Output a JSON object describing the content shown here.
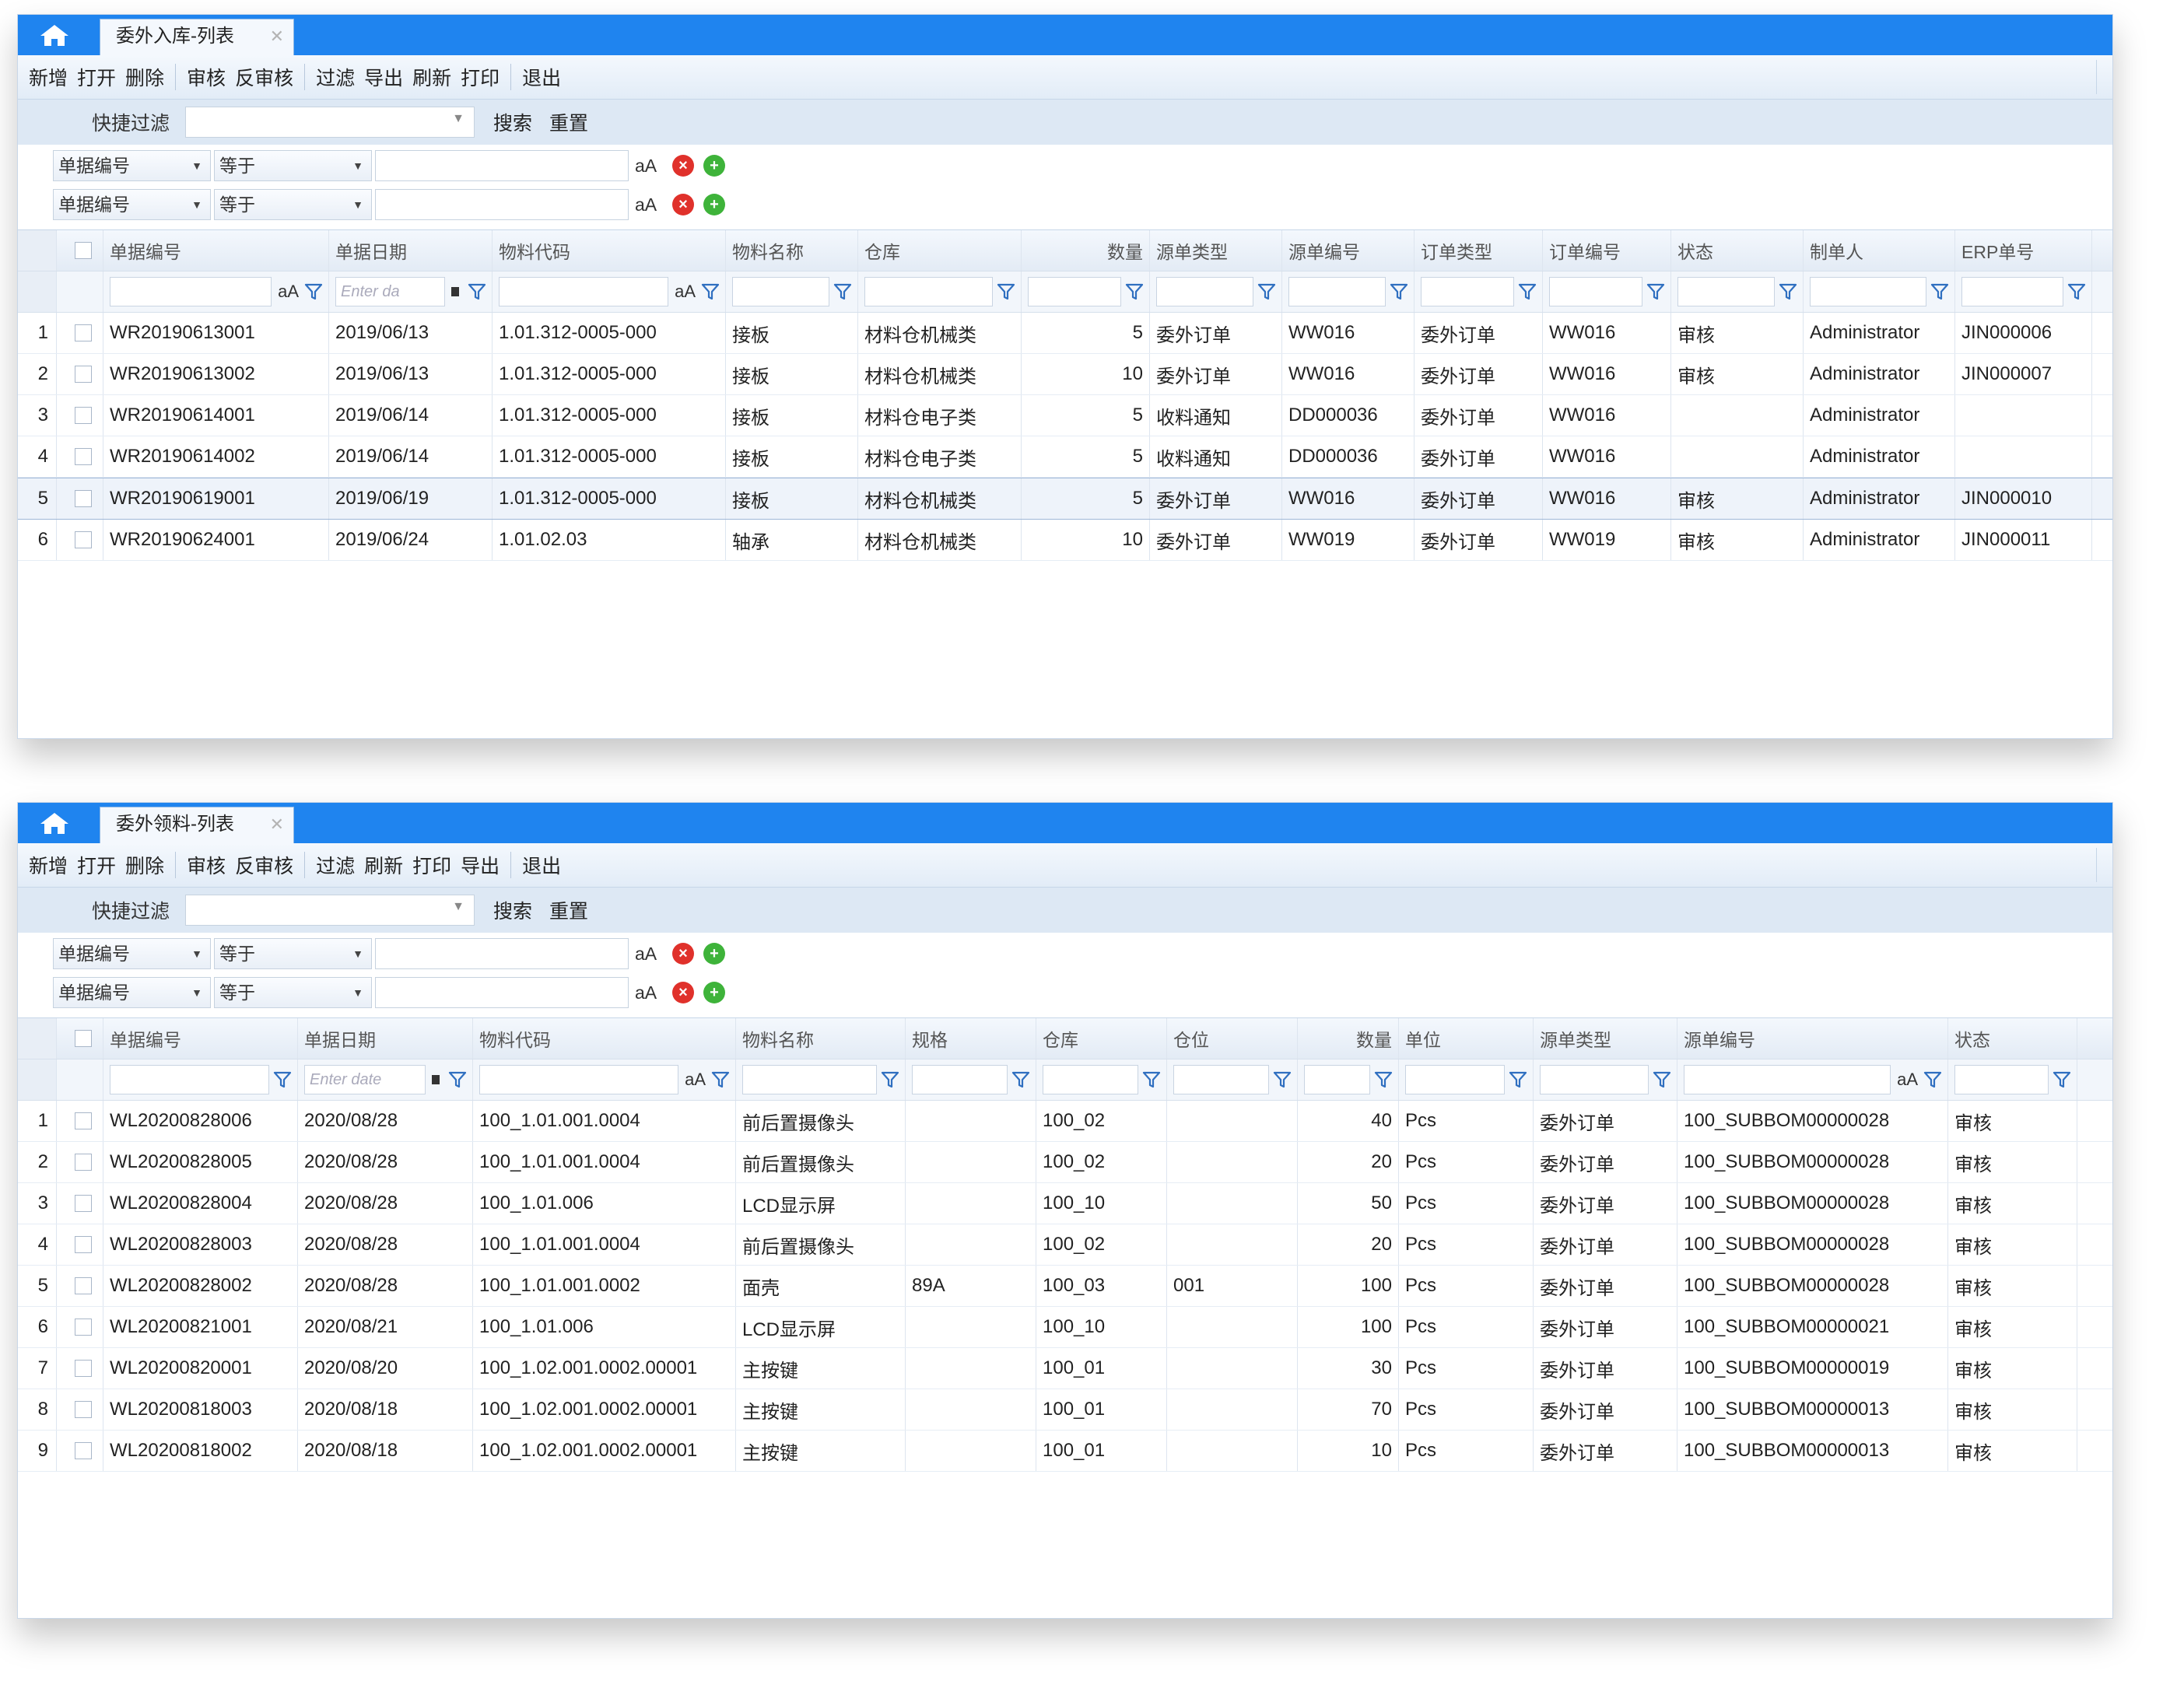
{
  "w1": {
    "tab": "委外入库-列表",
    "toolbar": [
      "新增",
      "打开",
      "删除",
      "审核",
      "反审核",
      "过滤",
      "导出",
      "刷新",
      "打印",
      "退出"
    ],
    "quick_filter_label": "快捷过滤",
    "search": "搜索",
    "reset": "重置",
    "filters": [
      {
        "field": "单据编号",
        "op": "等于"
      },
      {
        "field": "单据编号",
        "op": "等于"
      }
    ],
    "aa": "aA",
    "date_placeholder": "Enter da",
    "columns": [
      "单据编号",
      "单据日期",
      "物料代码",
      "物料名称",
      "仓库",
      "数量",
      "源单类型",
      "源单编号",
      "订单类型",
      "订单编号",
      "状态",
      "制单人",
      "ERP单号"
    ],
    "rows": [
      [
        "1",
        "WR20190613001",
        "2019/06/13",
        "1.01.312-0005-000",
        "接板",
        "材料仓机械类",
        "5",
        "委外订单",
        "WW016",
        "委外订单",
        "WW016",
        "审核",
        "Administrator",
        "JIN000006"
      ],
      [
        "2",
        "WR20190613002",
        "2019/06/13",
        "1.01.312-0005-000",
        "接板",
        "材料仓机械类",
        "10",
        "委外订单",
        "WW016",
        "委外订单",
        "WW016",
        "审核",
        "Administrator",
        "JIN000007"
      ],
      [
        "3",
        "WR20190614001",
        "2019/06/14",
        "1.01.312-0005-000",
        "接板",
        "材料仓电子类",
        "5",
        "收料通知",
        "DD000036",
        "委外订单",
        "WW016",
        "",
        "Administrator",
        ""
      ],
      [
        "4",
        "WR20190614002",
        "2019/06/14",
        "1.01.312-0005-000",
        "接板",
        "材料仓电子类",
        "5",
        "收料通知",
        "DD000036",
        "委外订单",
        "WW016",
        "",
        "Administrator",
        ""
      ],
      [
        "5",
        "WR20190619001",
        "2019/06/19",
        "1.01.312-0005-000",
        "接板",
        "材料仓机械类",
        "5",
        "委外订单",
        "WW016",
        "委外订单",
        "WW016",
        "审核",
        "Administrator",
        "JIN000010"
      ],
      [
        "6",
        "WR20190624001",
        "2019/06/24",
        "1.01.02.03",
        "轴承",
        "材料仓机械类",
        "10",
        "委外订单",
        "WW019",
        "委外订单",
        "WW019",
        "审核",
        "Administrator",
        "JIN000011"
      ]
    ]
  },
  "w2": {
    "tab": "委外领料-列表",
    "toolbar": [
      "新增",
      "打开",
      "删除",
      "审核",
      "反审核",
      "过滤",
      "刷新",
      "打印",
      "导出",
      "退出"
    ],
    "quick_filter_label": "快捷过滤",
    "search": "搜索",
    "reset": "重置",
    "filters": [
      {
        "field": "单据编号",
        "op": "等于"
      },
      {
        "field": "单据编号",
        "op": "等于"
      }
    ],
    "aa": "aA",
    "date_placeholder": "Enter date",
    "columns": [
      "单据编号",
      "单据日期",
      "物料代码",
      "物料名称",
      "规格",
      "仓库",
      "仓位",
      "数量",
      "单位",
      "源单类型",
      "源单编号",
      "状态"
    ],
    "rows": [
      [
        "1",
        "WL20200828006",
        "2020/08/28",
        "100_1.01.001.0004",
        "前后置摄像头",
        "",
        "100_02",
        "",
        "40",
        "Pcs",
        "委外订单",
        "100_SUBBOM00000028",
        "审核"
      ],
      [
        "2",
        "WL20200828005",
        "2020/08/28",
        "100_1.01.001.0004",
        "前后置摄像头",
        "",
        "100_02",
        "",
        "20",
        "Pcs",
        "委外订单",
        "100_SUBBOM00000028",
        "审核"
      ],
      [
        "3",
        "WL20200828004",
        "2020/08/28",
        "100_1.01.006",
        "LCD显示屏",
        "",
        "100_10",
        "",
        "50",
        "Pcs",
        "委外订单",
        "100_SUBBOM00000028",
        "审核"
      ],
      [
        "4",
        "WL20200828003",
        "2020/08/28",
        "100_1.01.001.0004",
        "前后置摄像头",
        "",
        "100_02",
        "",
        "20",
        "Pcs",
        "委外订单",
        "100_SUBBOM00000028",
        "审核"
      ],
      [
        "5",
        "WL20200828002",
        "2020/08/28",
        "100_1.01.001.0002",
        "面壳",
        "89A",
        "100_03",
        "001",
        "100",
        "Pcs",
        "委外订单",
        "100_SUBBOM00000028",
        "审核"
      ],
      [
        "6",
        "WL20200821001",
        "2020/08/21",
        "100_1.01.006",
        "LCD显示屏",
        "",
        "100_10",
        "",
        "100",
        "Pcs",
        "委外订单",
        "100_SUBBOM00000021",
        "审核"
      ],
      [
        "7",
        "WL20200820001",
        "2020/08/20",
        "100_1.02.001.0002.00001",
        "主按键",
        "",
        "100_01",
        "",
        "30",
        "Pcs",
        "委外订单",
        "100_SUBBOM00000019",
        "审核"
      ],
      [
        "8",
        "WL20200818003",
        "2020/08/18",
        "100_1.02.001.0002.00001",
        "主按键",
        "",
        "100_01",
        "",
        "70",
        "Pcs",
        "委外订单",
        "100_SUBBOM00000013",
        "审核"
      ],
      [
        "9",
        "WL20200818002",
        "2020/08/18",
        "100_1.02.001.0002.00001",
        "主按键",
        "",
        "100_01",
        "",
        "10",
        "Pcs",
        "委外订单",
        "100_SUBBOM00000013",
        "审核"
      ]
    ]
  }
}
